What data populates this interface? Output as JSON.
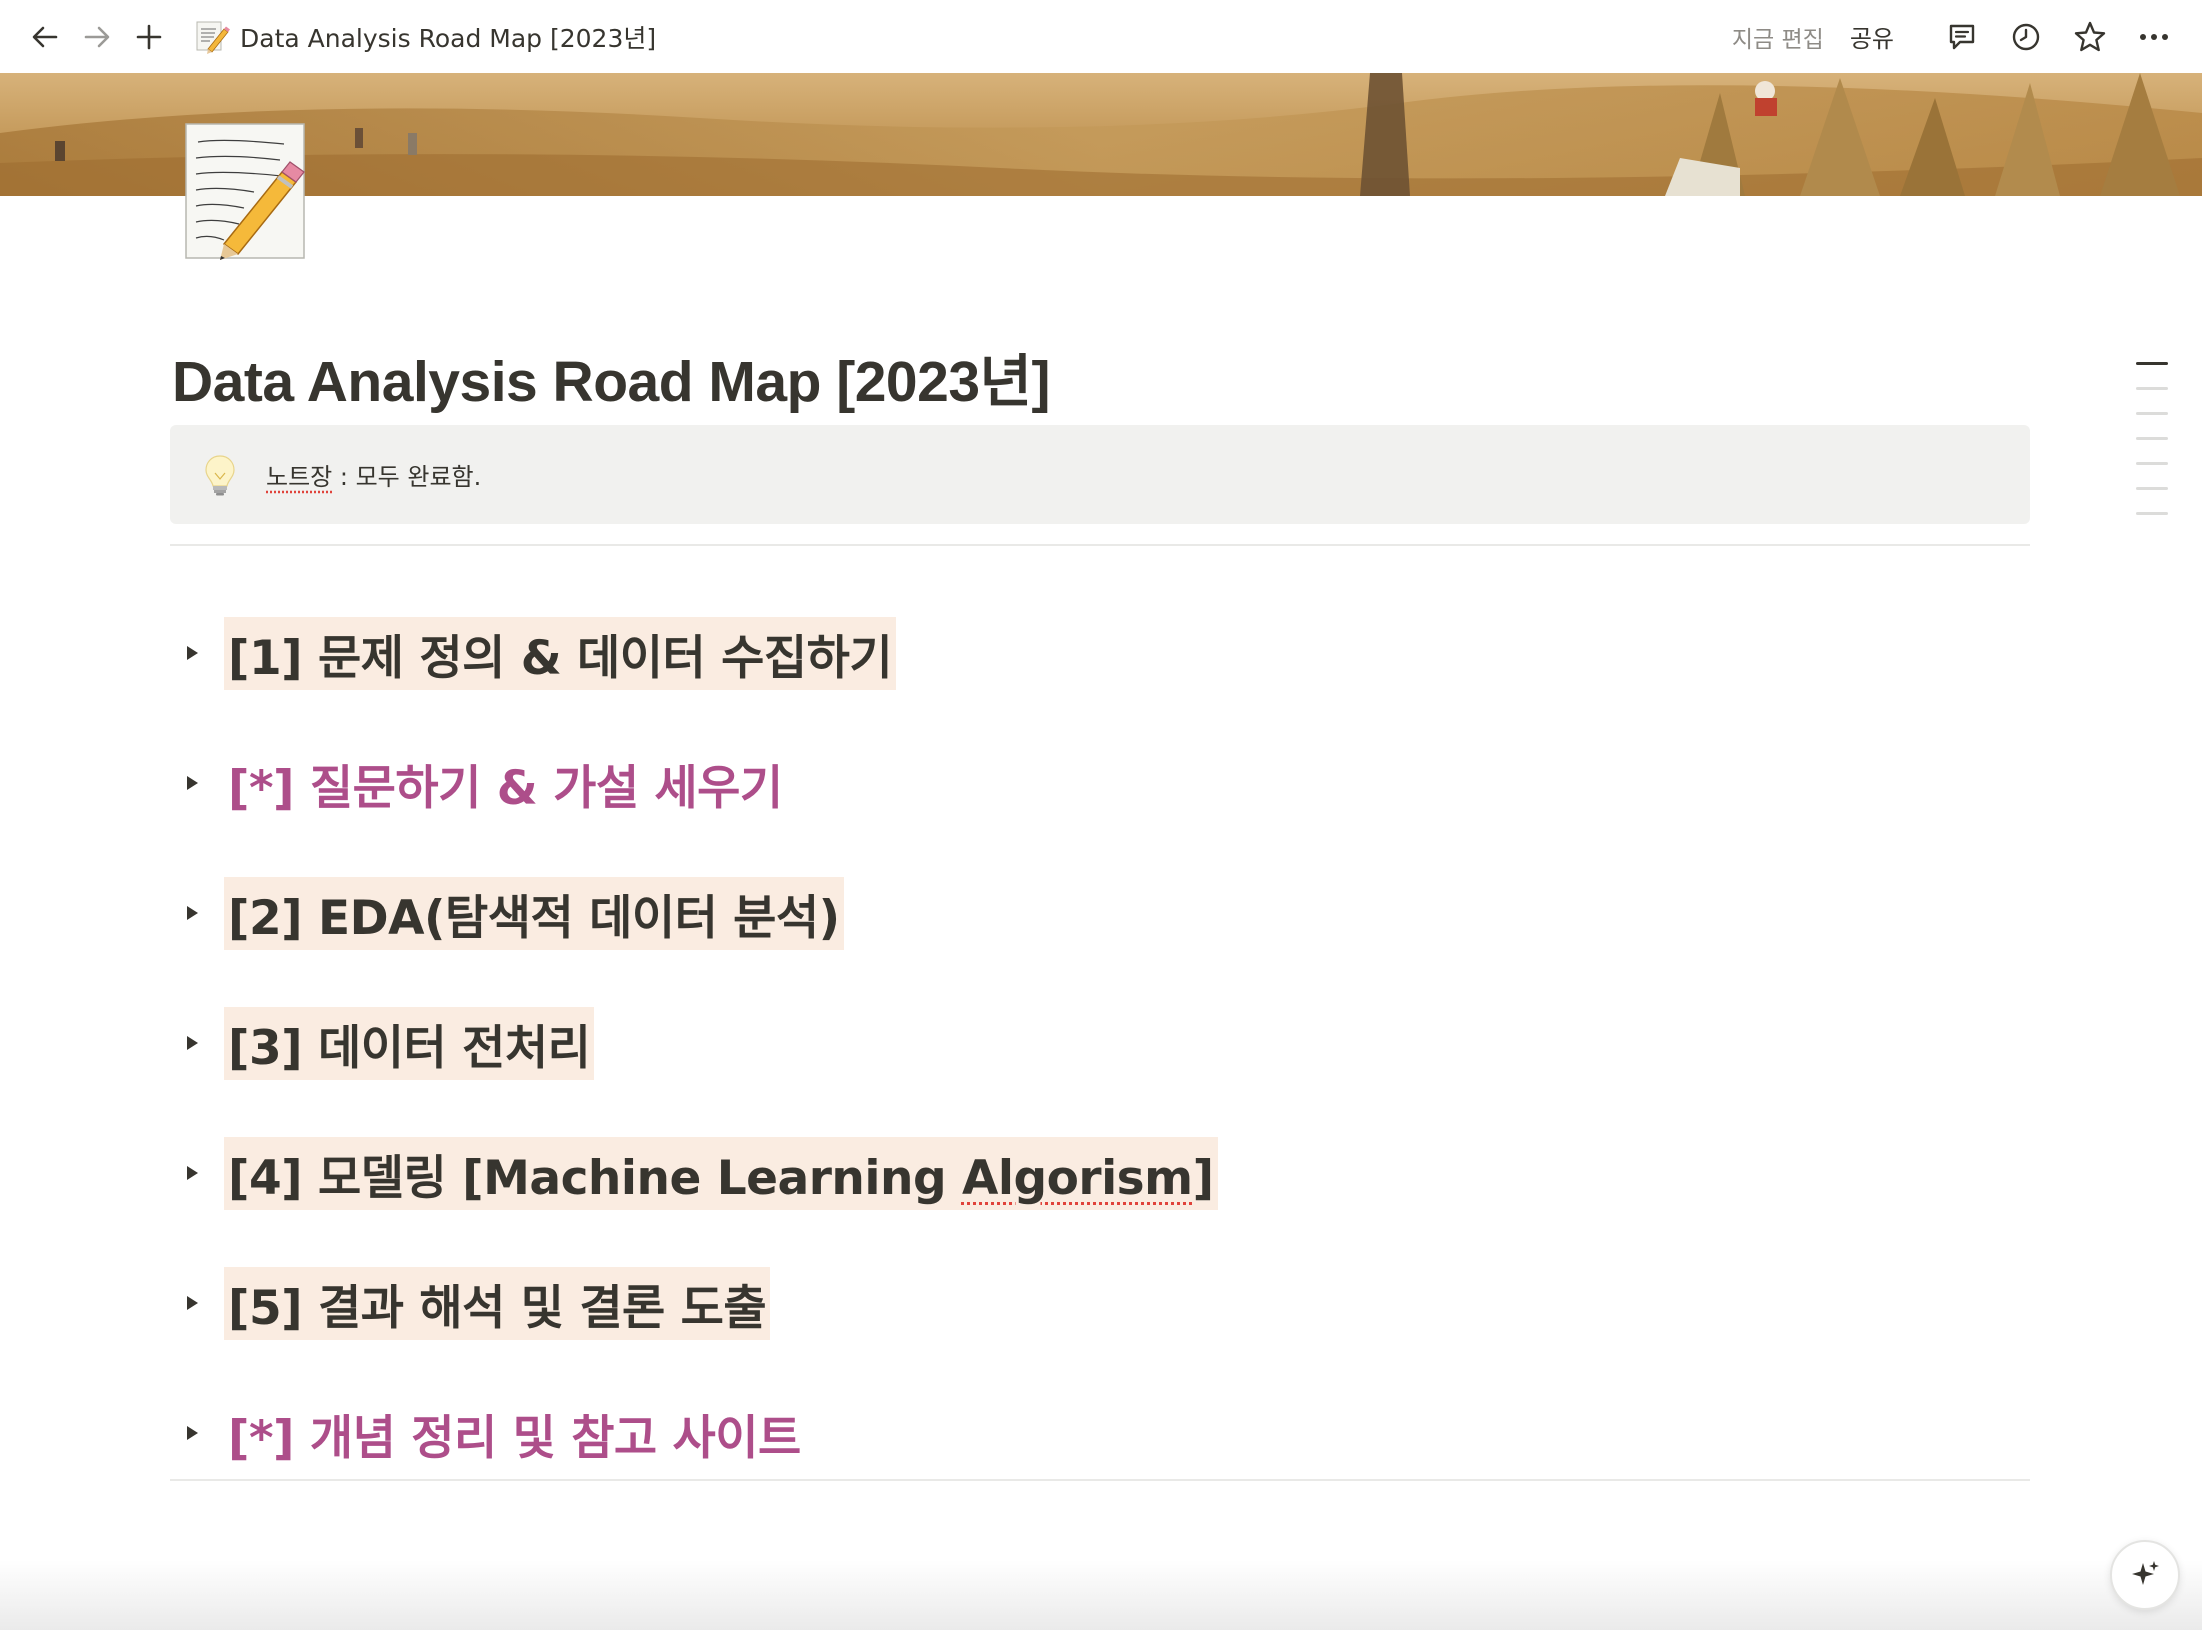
{
  "topbar": {
    "page_title": "Data Analysis Road Map [2023년]",
    "edited_label": "지금 편집",
    "share_label": "공유",
    "icons": [
      "back-arrow-icon",
      "forward-arrow-icon",
      "plus-icon",
      "comment-icon",
      "history-clock-icon",
      "star-icon",
      "more-dots-icon"
    ]
  },
  "page": {
    "title": "Data Analysis Road Map [2023년]",
    "icon": "memo-pencil-icon",
    "callout": {
      "icon": "lightbulb-icon",
      "key": "노트장",
      "rest": " : 모두 완료함."
    }
  },
  "toggles": [
    {
      "label": "[1] 문제 정의 & 데이터 수집하기",
      "style": "orange-background"
    },
    {
      "label": "[*] 질문하기 & 가설 세우기",
      "style": "pink-text"
    },
    {
      "label": "[2] EDA(탐색적 데이터 분석)",
      "style": "orange-background"
    },
    {
      "label": "[3] 데이터 전처리",
      "style": "orange-background"
    },
    {
      "label_pre": "[4] 모델링 [Machine Learning ",
      "label_spell": "Algorism",
      "label_post": "]",
      "style": "orange-background"
    },
    {
      "label": "[5] 결과 해석 및 결론 도출",
      "style": "orange-background"
    },
    {
      "label": "[*] 개념 정리 및 참고 사이트",
      "style": "pink-text"
    }
  ],
  "colors": {
    "text": "#37352f",
    "orange_highlight": "#faece1",
    "pink_text": "#ad4e8a",
    "callout_bg": "#f1f1ef"
  }
}
